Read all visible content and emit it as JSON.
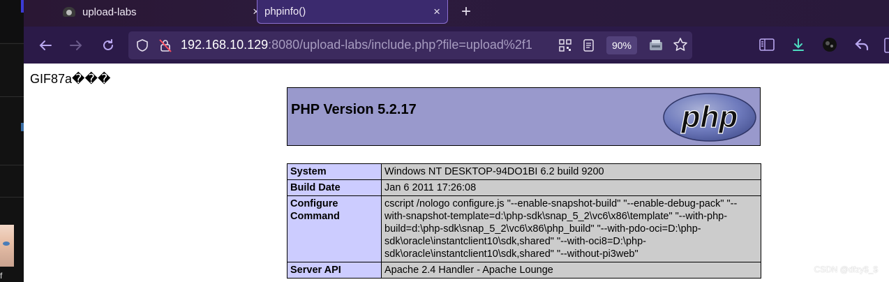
{
  "tabs": [
    {
      "label": "upload-labs",
      "icon": "spider-favicon",
      "close": "×"
    },
    {
      "label": "phpinfo()",
      "active": true,
      "close": "×"
    }
  ],
  "new_tab_symbol": "+",
  "address_bar": {
    "host": "192.168.10.129",
    "rest": ":8080/upload-labs/include.php?file=upload%2f1",
    "zoom": "90%"
  },
  "page": {
    "gif_header": "GIF87a���",
    "php_version": "PHP Version 5.2.17",
    "logo_text": "php",
    "rows": [
      {
        "key": "System",
        "value": "Windows NT DESKTOP-94DO1BI 6.2 build 9200"
      },
      {
        "key": "Build Date",
        "value": "Jan 6 2011 17:26:08"
      },
      {
        "key": "Configure Command",
        "value": "cscript /nologo configure.js \"--enable-snapshot-build\" \"--enable-debug-pack\" \"--with-snapshot-template=d:\\php-sdk\\snap_5_2\\vc6\\x86\\template\" \"--with-php-build=d:\\php-sdk\\snap_5_2\\vc6\\x86\\php_build\" \"--with-pdo-oci=D:\\php-sdk\\oracle\\instantclient10\\sdk,shared\" \"--with-oci8=D:\\php-sdk\\oracle\\instantclient10\\sdk,shared\" \"--without-pi3web\""
      },
      {
        "key": "Server API",
        "value": "Apache 2.4 Handler - Apache Lounge"
      }
    ]
  },
  "watermark": "CSDN @dfzy$_$",
  "left_strip_letter": "f",
  "colors": {
    "header_bg": "#9999cc",
    "key_bg": "#ccccff",
    "value_bg": "#cccccc",
    "toolbar_bg": "#2b1a48",
    "accent": "#4ddcc0"
  }
}
